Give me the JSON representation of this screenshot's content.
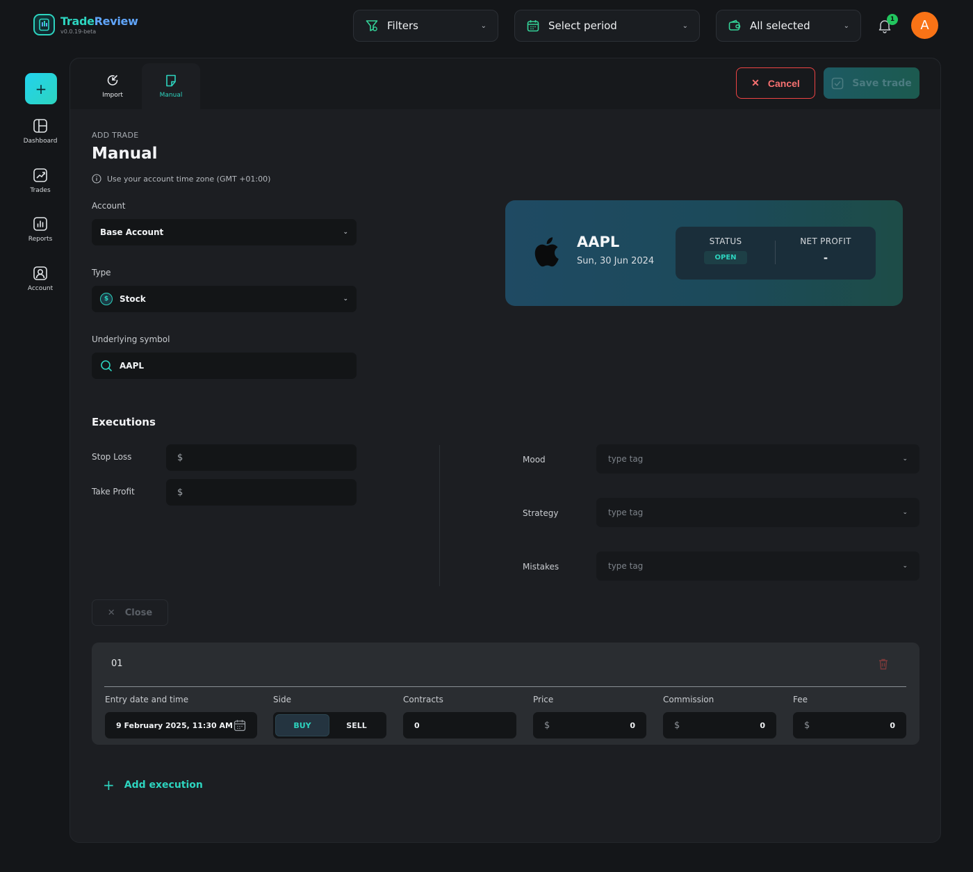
{
  "app": {
    "name_a": "Trade",
    "name_b": "Review",
    "version": "v0.0.19-beta"
  },
  "topbar": {
    "filters_label": "Filters",
    "period_label": "Select period",
    "accounts_label": "All selected",
    "notification_count": "1",
    "avatar_initial": "A"
  },
  "sidebar": {
    "items": [
      {
        "label": "Dashboard",
        "icon": "dashboard-icon"
      },
      {
        "label": "Trades",
        "icon": "trades-icon"
      },
      {
        "label": "Reports",
        "icon": "reports-icon"
      },
      {
        "label": "Account",
        "icon": "account-icon"
      }
    ]
  },
  "tabs": {
    "import_label": "Import",
    "manual_label": "Manual"
  },
  "actions": {
    "cancel_label": "Cancel",
    "save_label": "Save trade"
  },
  "form": {
    "overline": "ADD TRADE",
    "title": "Manual",
    "timezone_note": "Use your account time zone (GMT +01:00)",
    "account_label": "Account",
    "account_value": "Base Account",
    "type_label": "Type",
    "type_value": "Stock",
    "symbol_label": "Underlying symbol",
    "symbol_value": "AAPL"
  },
  "summary": {
    "symbol": "AAPL",
    "date": "Sun, 30 Jun 2024",
    "status_header": "STATUS",
    "status_value": "OPEN",
    "net_profit_header": "NET PROFIT",
    "net_profit_value": "-"
  },
  "executions": {
    "title": "Executions",
    "stop_loss_label": "Stop Loss",
    "take_profit_label": "Take Profit",
    "currency": "$",
    "mood_label": "Mood",
    "strategy_label": "Strategy",
    "mistakes_label": "Mistakes",
    "tag_placeholder": "type tag",
    "close_label": "Close",
    "add_label": "Add execution",
    "row": {
      "number": "01",
      "entry_label": "Entry date and time",
      "entry_value": "9 February 2025, 11:30 AM",
      "side_label": "Side",
      "buy_label": "BUY",
      "sell_label": "SELL",
      "contracts_label": "Contracts",
      "contracts_value": "0",
      "price_label": "Price",
      "price_value": "0",
      "commission_label": "Commission",
      "commission_value": "0",
      "fee_label": "Fee",
      "fee_value": "0"
    }
  },
  "colors": {
    "accent": "#2dd4bf",
    "danger": "#ef4444",
    "avatar": "#f97316",
    "background": "#141619",
    "panel": "#1c1e22"
  }
}
